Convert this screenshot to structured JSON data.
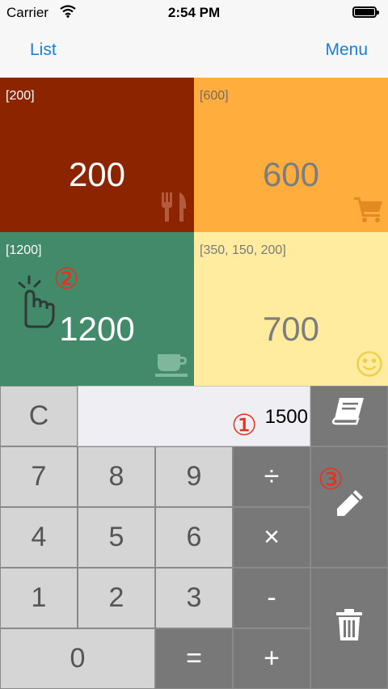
{
  "status_bar": {
    "carrier": "Carrier",
    "time": "2:54 PM",
    "icons": [
      "wifi-icon",
      "battery-icon"
    ]
  },
  "nav": {
    "left_button": "List",
    "right_button": "Menu",
    "accent_color": "#1a7fe0"
  },
  "tiles": [
    {
      "label": "[200]",
      "value": "200",
      "icon": "fork-knife-icon",
      "color": "#8c2400"
    },
    {
      "label": "[600]",
      "value": "600",
      "icon": "cart-icon",
      "color": "#ffae3d"
    },
    {
      "label": "[1200]",
      "value": "1200",
      "icon": "coffee-cup-icon",
      "color": "#428a69"
    },
    {
      "label": "[350, 150, 200]",
      "value": "700",
      "icon": "smiley-icon",
      "color": "#ffec9e"
    }
  ],
  "annotations": {
    "m1": "①",
    "m2": "②",
    "m3": "③",
    "color": "#e8301c"
  },
  "calculator": {
    "display_value": "1500",
    "keys": {
      "clear": "C",
      "seven": "7",
      "eight": "8",
      "nine": "9",
      "divide": "÷",
      "four": "4",
      "five": "5",
      "six": "6",
      "multiply": "×",
      "one": "1",
      "two": "2",
      "three": "3",
      "minus": "-",
      "zero": "0",
      "equals": "=",
      "plus": "+"
    },
    "side_icons": [
      "book-icon",
      "pencil-icon",
      "trash-icon"
    ]
  }
}
